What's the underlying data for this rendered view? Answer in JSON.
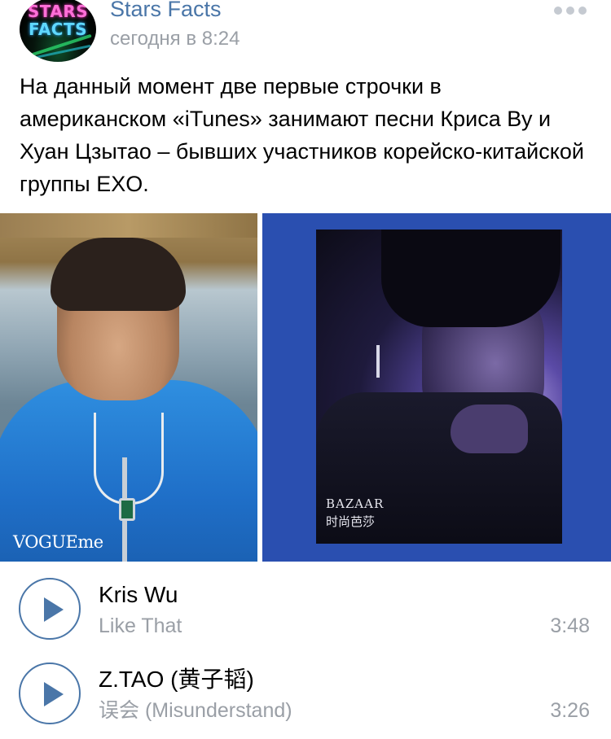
{
  "post": {
    "author": "Stars Facts",
    "time": "сегодня в 8:24",
    "avatar_text": [
      "STARS",
      "FACTS"
    ],
    "text": "На данный момент две первые строчки в американском «iTunes» занимают песни Криса Ву и Хуан Цзытао – бывших участников корейско-китайской группы EXO.",
    "photos": [
      {
        "caption": "VOGUEme"
      },
      {
        "caption_line1": "BAZAAR",
        "caption_line2": "时尚芭莎"
      }
    ]
  },
  "tracks": [
    {
      "artist": "Kris Wu",
      "title": "Like That",
      "duration": "3:48"
    },
    {
      "artist": "Z.TAO (黄子韬)",
      "title": "误会 (Misunderstand)",
      "duration": "3:26"
    }
  ],
  "colors": {
    "accent": "#4a76a8",
    "secondary_text": "#9a9fa6",
    "more_dots": "#c5cad1",
    "right_photo_bg": "#2a4fb0"
  },
  "icons": {
    "more": "more-dots-icon",
    "play": "play-icon"
  }
}
